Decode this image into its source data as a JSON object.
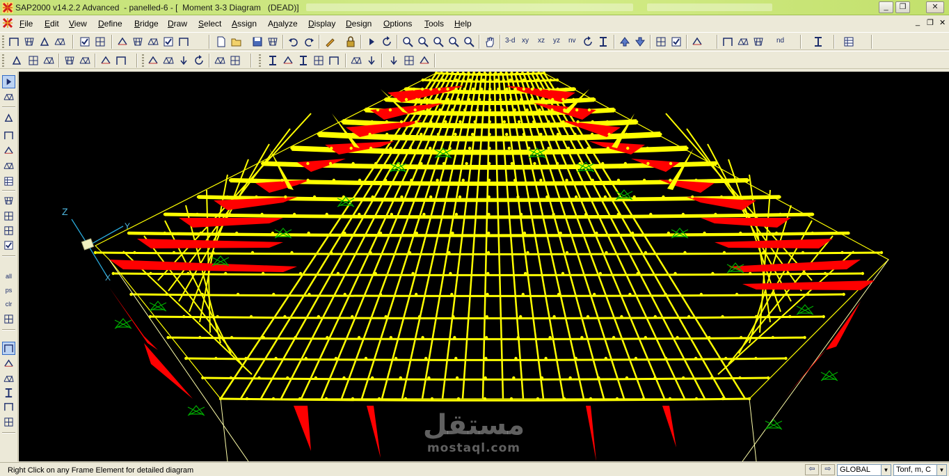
{
  "window": {
    "title": "SAP2000 v14.2.2 Advanced  - panelled-6 - [  Moment 3-3 Diagram   (DEAD)]",
    "minimize_label": "_",
    "restore_label": "❐",
    "close_label": "✕"
  },
  "menu": {
    "items": [
      {
        "label": "File"
      },
      {
        "label": "Edit"
      },
      {
        "label": "View"
      },
      {
        "label": "Define"
      },
      {
        "label": "Bridge"
      },
      {
        "label": "Draw"
      },
      {
        "label": "Select"
      },
      {
        "label": "Assign"
      },
      {
        "label": "Analyze"
      },
      {
        "label": "Display"
      },
      {
        "label": "Design"
      },
      {
        "label": "Options"
      },
      {
        "label": "Tools"
      },
      {
        "label": "Help"
      }
    ],
    "mdi_minimize": "_",
    "mdi_restore": "❐",
    "mdi_close": "✕"
  },
  "toolbar": {
    "view_3d": "3-d",
    "view_xy": "xy",
    "view_xz": "xz",
    "view_yz": "yz",
    "view_nv": "nv",
    "nd_label": "nd"
  },
  "left_toolbar": {
    "all_label": "all",
    "ps_label": "ps",
    "clr_label": "clr"
  },
  "viewport": {
    "axis_z": "Z",
    "axis_y": "Y",
    "axis_x": "X",
    "colors": {
      "background": "#000000",
      "structure": "#ffff00",
      "positive_moment": "#ffff00",
      "negative_moment": "#ff0000",
      "supports": "#00b000"
    }
  },
  "watermark": {
    "arabic": "مستقل",
    "latin": "mostaql.com"
  },
  "status": {
    "message": "Right Click on any Frame Element for detailed diagram",
    "coord_system": "GLOBAL",
    "units": "Tonf, m, C"
  }
}
